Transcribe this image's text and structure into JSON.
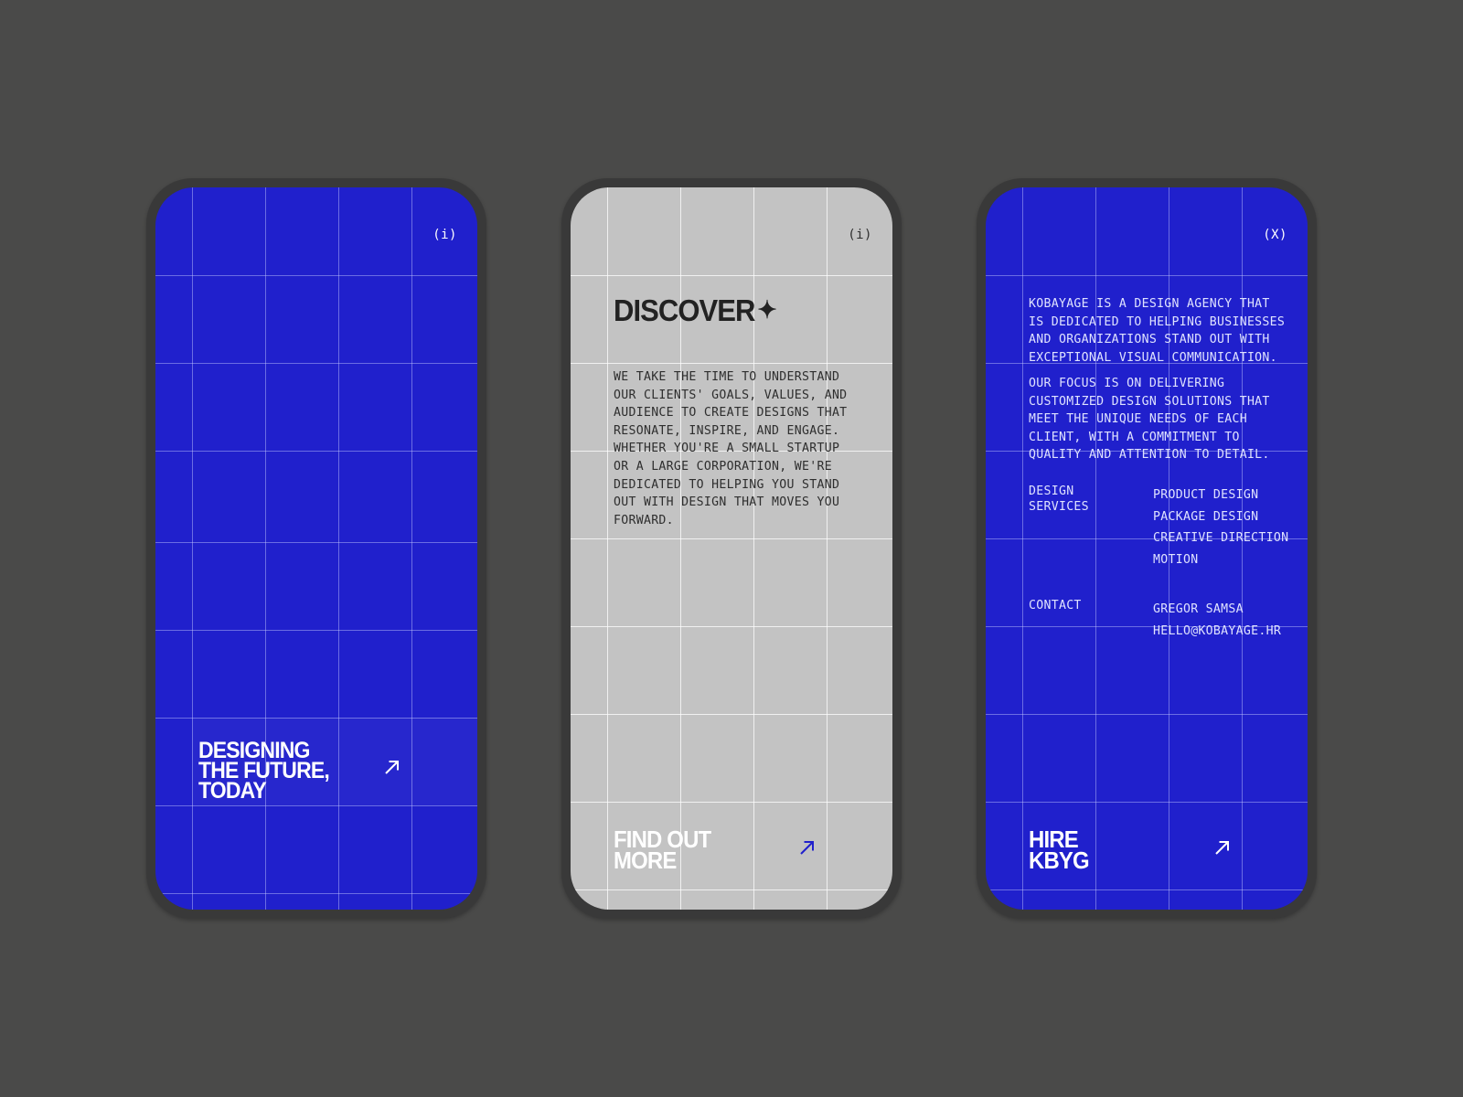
{
  "theme": {
    "background": "#4a4a49",
    "bezel": "#393939",
    "blue": "#2020cc",
    "grey": "#c3c3c3",
    "white": "#ffffff",
    "dark_text": "#2e2e2e",
    "light_blue_text": "#dfe2ff"
  },
  "grid": {
    "columns": 5,
    "rows": 8,
    "first_column_narrow": true
  },
  "screens": [
    {
      "id": "screen-home",
      "theme": "blue",
      "corner_tag": "(i)",
      "corner_tag_icon": "info-icon",
      "cta": {
        "label": "DESIGNING\nTHE FUTURE,\nTODAY",
        "arrow_icon": "arrow-up-right-icon",
        "arrow_color": "#ffffff"
      }
    },
    {
      "id": "screen-discover",
      "theme": "grey",
      "corner_tag": "(i)",
      "corner_tag_icon": "info-icon",
      "heading": "DISCOVER",
      "heading_star": "✦",
      "body": "WE TAKE THE TIME TO UNDERSTAND\nOUR CLIENTS' GOALS, VALUES, AND\nAUDIENCE TO CREATE DESIGNS THAT\nRESONATE, INSPIRE, AND ENGAGE.\nWHETHER YOU'RE A SMALL STARTUP\nOR A LARGE CORPORATION, WE'RE\nDEDICATED TO HELPING YOU STAND\nOUT WITH DESIGN THAT MOVES YOU\nFORWARD.",
      "cta": {
        "label": "FIND OUT\nMORE",
        "arrow_icon": "arrow-up-right-icon",
        "arrow_color": "#2020cc"
      }
    },
    {
      "id": "screen-about",
      "theme": "blue",
      "corner_tag": "(X)",
      "corner_tag_icon": "close-icon",
      "intro": "KOBAYAGE IS A DESIGN AGENCY THAT\nIS DEDICATED TO HELPING BUSINESSES\nAND ORGANIZATIONS STAND OUT WITH\nEXCEPTIONAL VISUAL COMMUNICATION.",
      "focus": "OUR FOCUS IS ON DELIVERING\nCUSTOMIZED DESIGN SOLUTIONS THAT\nMEET THE UNIQUE NEEDS OF EACH\nCLIENT, WITH A COMMITMENT TO\nQUALITY AND ATTENTION TO DETAIL.",
      "services": {
        "label": "DESIGN\nSERVICES",
        "items": [
          "PRODUCT DESIGN",
          "PACKAGE DESIGN",
          "CREATIVE DIRECTION",
          "MOTION"
        ]
      },
      "contact": {
        "label": "CONTACT",
        "items": [
          "GREGOR SAMSA",
          "HELLO@KOBAYAGE.HR"
        ]
      },
      "cta": {
        "label": "HIRE\nKBYG",
        "arrow_icon": "arrow-up-right-icon",
        "arrow_color": "#ffffff"
      }
    }
  ]
}
